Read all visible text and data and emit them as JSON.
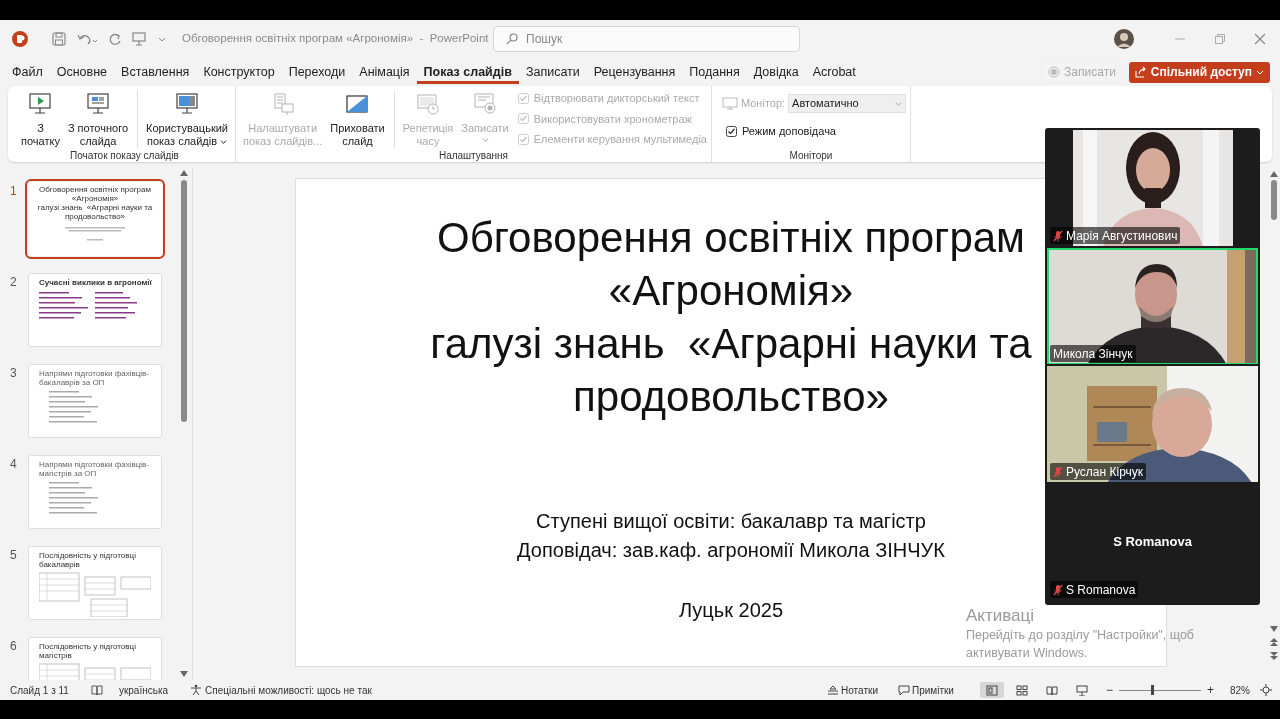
{
  "title_bar": {
    "document_title": "Обговорення освітніх програм «Агрономія»  -  PowerPoint",
    "search_placeholder": "Пошук"
  },
  "tabs": [
    {
      "label": "Файл",
      "selected": false
    },
    {
      "label": "Основне",
      "selected": false
    },
    {
      "label": "Вставлення",
      "selected": false
    },
    {
      "label": "Конструктор",
      "selected": false
    },
    {
      "label": "Переходи",
      "selected": false
    },
    {
      "label": "Анімація",
      "selected": false
    },
    {
      "label": "Показ слайдів",
      "selected": true
    },
    {
      "label": "Записати",
      "selected": false
    },
    {
      "label": "Рецензування",
      "selected": false
    },
    {
      "label": "Подання",
      "selected": false
    },
    {
      "label": "Довідка",
      "selected": false
    },
    {
      "label": "Acrobat",
      "selected": false
    }
  ],
  "record_button": {
    "label": "Записати",
    "disabled": true
  },
  "share_button": {
    "label": "Спільний доступ"
  },
  "ribbon_groups": [
    {
      "title": "Початок показу слайдів",
      "items": [
        {
          "kind": "button",
          "label": "З\nпочатку",
          "disabled": false,
          "has_menu": false,
          "separator_before": false
        },
        {
          "kind": "button",
          "label": "З поточного\nслайда",
          "disabled": false,
          "has_menu": false,
          "separator_before": false
        },
        {
          "kind": "button",
          "label": "Користувацький\nпоказ слайдів",
          "disabled": false,
          "has_menu": true,
          "separator_before": true
        }
      ]
    },
    {
      "title": "Налаштування",
      "items": [
        {
          "kind": "button",
          "label": "Налаштувати\nпоказ слайдів...",
          "disabled": true,
          "has_menu": false,
          "separator_before": false
        },
        {
          "kind": "button",
          "label": "Приховати\nслайд",
          "disabled": false,
          "has_menu": false,
          "separator_before": false
        },
        {
          "kind": "button",
          "label": "Репетиція\nчасу",
          "disabled": true,
          "has_menu": false,
          "separator_before": true
        },
        {
          "kind": "button",
          "label": "Записати",
          "disabled": true,
          "has_menu": true,
          "separator_before": false
        },
        {
          "kind": "checkbox_stack",
          "checkboxes": [
            {
              "label": "Відтворювати дикторський текст",
              "checked": true,
              "disabled": true
            },
            {
              "label": "Використовувати хронометраж",
              "checked": true,
              "disabled": true
            },
            {
              "label": "Елементи керування мультимедіа",
              "checked": true,
              "disabled": true
            }
          ]
        }
      ]
    },
    {
      "title": "Монітори",
      "items": [
        {
          "kind": "monitor_picker",
          "label": "Монітор:",
          "value": "Автоматично",
          "disabled": true
        },
        {
          "kind": "checkbox",
          "label": "Режим доповідача",
          "checked": true,
          "disabled": false
        }
      ]
    }
  ],
  "thumbnails": [
    {
      "number": "1",
      "selected": true,
      "kind": "title",
      "title": "Обговорення освітніх програм\n«Агрономія»\nгалузі знань  «Аграрні науки та\nпродовольство»"
    },
    {
      "number": "2",
      "selected": false,
      "kind": "list",
      "title": "Сучасні виклики в агрономії"
    },
    {
      "number": "3",
      "selected": false,
      "kind": "list",
      "title": "Напрями підготовки фахівців-бакалаврів за ОП"
    },
    {
      "number": "4",
      "selected": false,
      "kind": "list",
      "title": "Напрями підготовки фахівців-магістрів за ОП"
    },
    {
      "number": "5",
      "selected": false,
      "kind": "table",
      "title": "Послідовність у підготовці бакалаврів"
    },
    {
      "number": "6",
      "selected": false,
      "kind": "table",
      "title": "Послідовність у підготовці магістрів"
    }
  ],
  "slide": {
    "title": "Обговорення освітніх програм\n«Агрономія»\nгалузі знань  «Аграрні науки та\nпродовольство»",
    "subtitle": "Ступені вищої освіти: бакалавр та магістр\nДоповідач: зав.каф. агрономії Микола ЗІНЧУК",
    "footer": "Луцьк 2025"
  },
  "video_call": {
    "participants": [
      {
        "kind": "video",
        "name": "Марія Августинович",
        "muted": true,
        "speaking": false
      },
      {
        "kind": "video",
        "name": "Микола Зінчук",
        "muted": false,
        "speaking": true
      },
      {
        "kind": "video",
        "name": "Руслан Кірчук",
        "muted": true,
        "speaking": false
      },
      {
        "kind": "no_video",
        "name": "S Romanova",
        "center_label": "S Romanova",
        "muted": true,
        "speaking": false
      }
    ]
  },
  "activation_notice": {
    "title": "Активаці",
    "text": "Перейдіть до розділу \"Настройки\", щоб\nактивувати Windows."
  },
  "status_bar": {
    "slide_counter": "Слайд 1 з 11",
    "language": "українська",
    "accessibility": "Спеціальні можливості: щось не так",
    "notes": "Нотатки",
    "comments": "Примітки",
    "views": [
      {
        "selected": true
      },
      {
        "selected": false
      },
      {
        "selected": false
      },
      {
        "selected": false
      }
    ],
    "zoom": {
      "minus": "−",
      "plus": "+",
      "level": 0.4,
      "reading": "82%"
    }
  }
}
